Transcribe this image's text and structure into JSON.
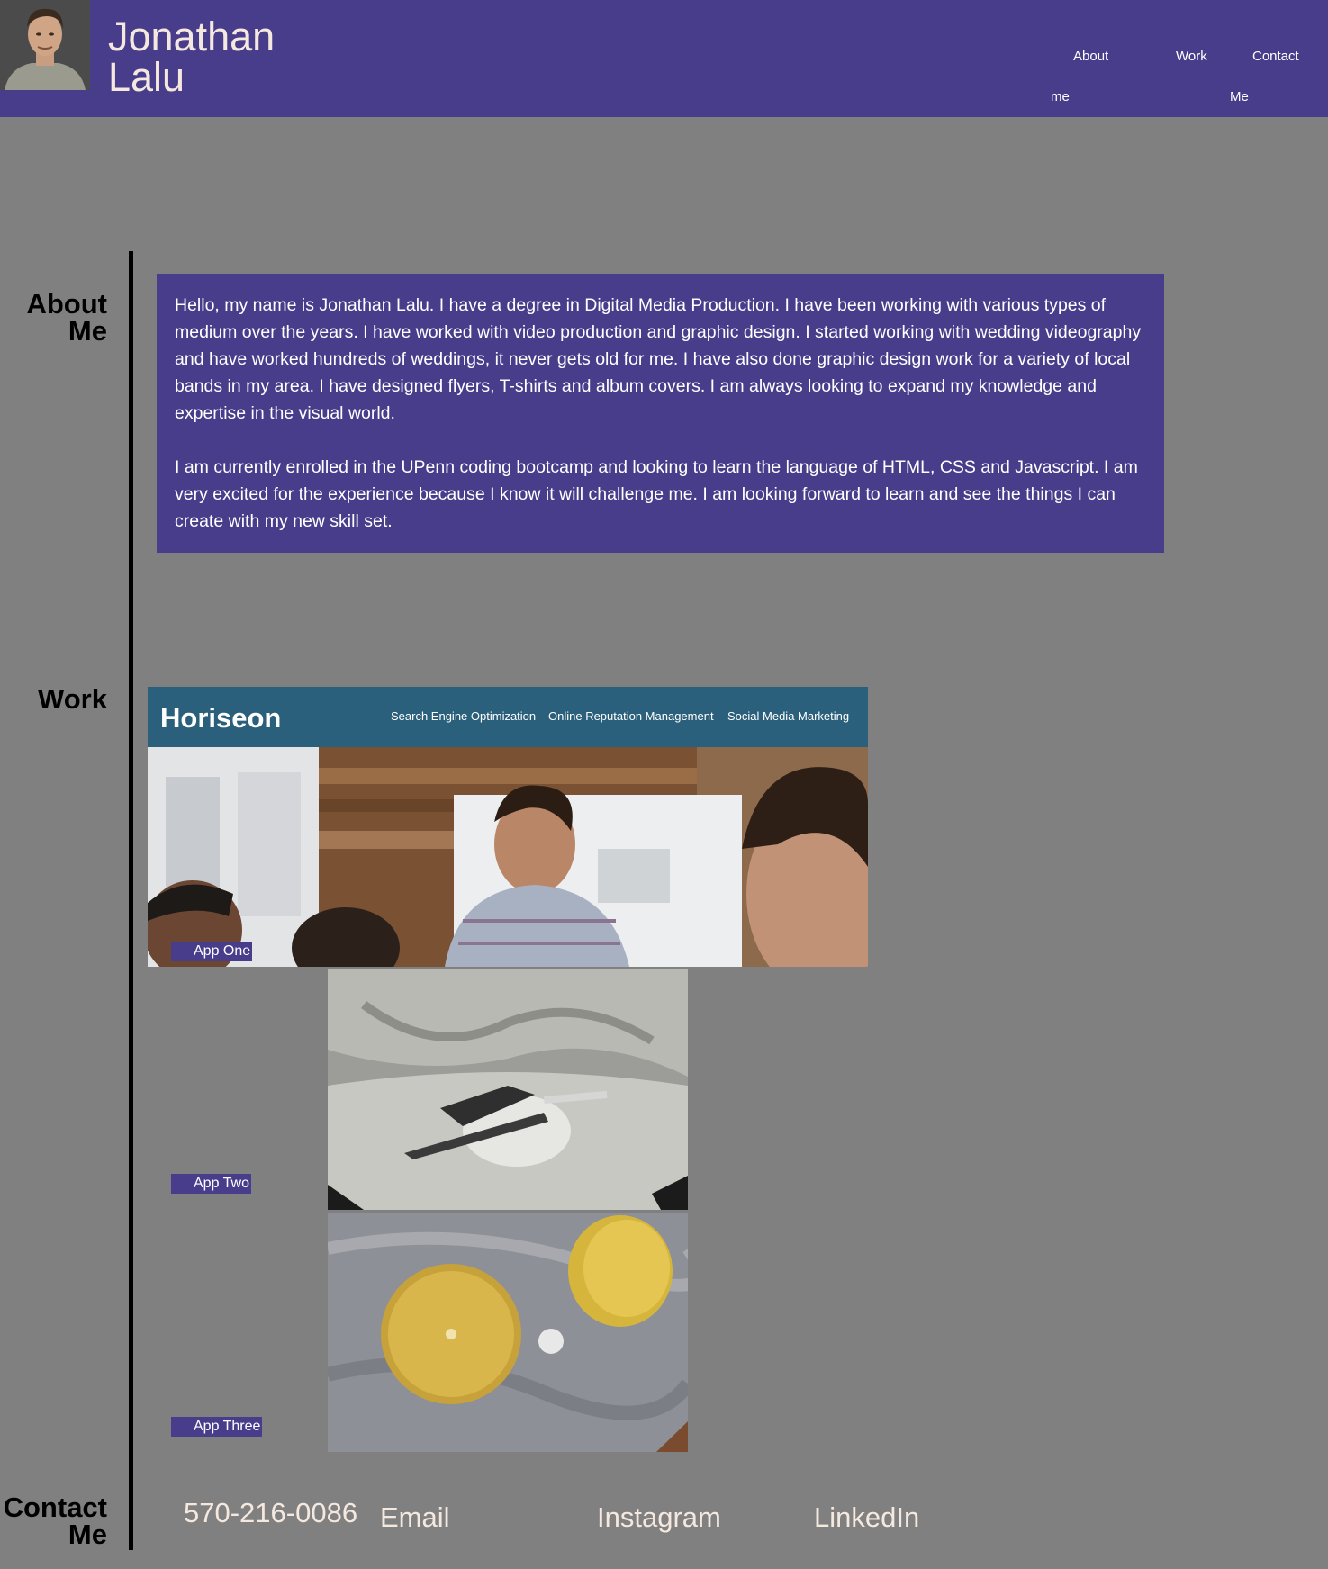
{
  "header": {
    "name_line1": "Jonathan",
    "name_line2": "Lalu",
    "nav": {
      "about_line1": "About",
      "about_line2": "me",
      "work": "Work",
      "contact_line1": "Contact",
      "contact_line2": "Me"
    }
  },
  "sections": {
    "about_title_line1": "About",
    "about_title_line2": "Me",
    "work_title": "Work",
    "contact_title_line1": "Contact",
    "contact_title_line2": "Me"
  },
  "about": {
    "paragraph1": "Hello, my name is Jonathan Lalu. I have a degree in Digital Media Production. I have been working with various types of medium over the years. I have worked with video production and graphic design. I started working with wedding videography and have worked hundreds of weddings, it never gets old for me. I have also done graphic design work for a variety of local bands in my area. I have designed flyers, T-shirts and album covers. I am always looking to expand my knowledge and expertise in the visual world.",
    "paragraph2": "I am currently enrolled in the UPenn coding bootcamp and looking to learn the language of HTML, CSS and Javascript. I am very excited for the experience because I know it will challenge me. I am looking forward to learn and see the things I can create with my new skill set."
  },
  "work": {
    "app_one": {
      "label": "App One",
      "screenshot_brand": "Horiseon",
      "screenshot_nav": [
        "Search Engine Optimization",
        "Online Reputation Management",
        "Social Media Marketing"
      ]
    },
    "app_two": {
      "label": "App Two"
    },
    "app_three": {
      "label": "App Three"
    }
  },
  "contact": {
    "phone": "570-216-0086",
    "email": "Email",
    "instagram": "Instagram",
    "linkedin": "LinkedIn"
  },
  "colors": {
    "brand_purple": "#483d8b",
    "page_gray": "#808080",
    "cream_text": "#f5e8df"
  }
}
